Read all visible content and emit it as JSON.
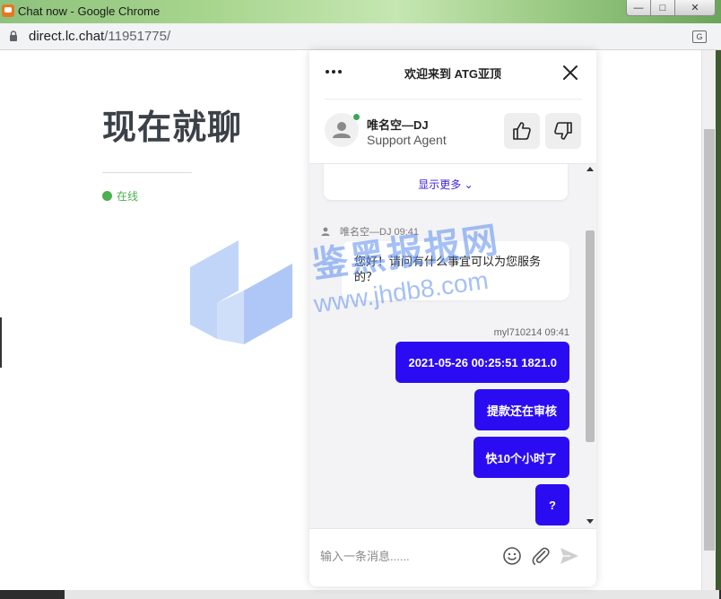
{
  "window": {
    "title": "Chat now - Google Chrome",
    "min_label": "—",
    "max_label": "□",
    "close_label": "✕"
  },
  "urlbar": {
    "host": "direct.lc.chat",
    "path": "/11951775/",
    "translate_label": "G"
  },
  "page": {
    "title": "现在就聊",
    "status": "在线"
  },
  "widget": {
    "title": "欢迎来到 ATG亚顶",
    "agent": {
      "name": "唯名空—DJ",
      "role": "Support Agent"
    },
    "show_more": "显示更多 ⌄",
    "messages": [
      {
        "author": "唯名空—DJ",
        "time": "09:41",
        "meta": "唯名空—DJ 09:41",
        "text": "您好！请问有什么事宜可以为您服务的？"
      }
    ],
    "visitor": {
      "meta": "myl710214 09:41",
      "messages": [
        "2021-05-26 00:25:51 1821.0",
        "提款还在审核",
        "快10个小时了",
        "?"
      ]
    },
    "composer": {
      "placeholder": "输入一条消息......"
    }
  },
  "watermark": {
    "text": "鉴黑报报网",
    "url": "www.jhdb8.com"
  },
  "colors": {
    "visitor_bubble": "#2b0cf2",
    "online": "#4caf50",
    "link": "#3a1fd6"
  }
}
